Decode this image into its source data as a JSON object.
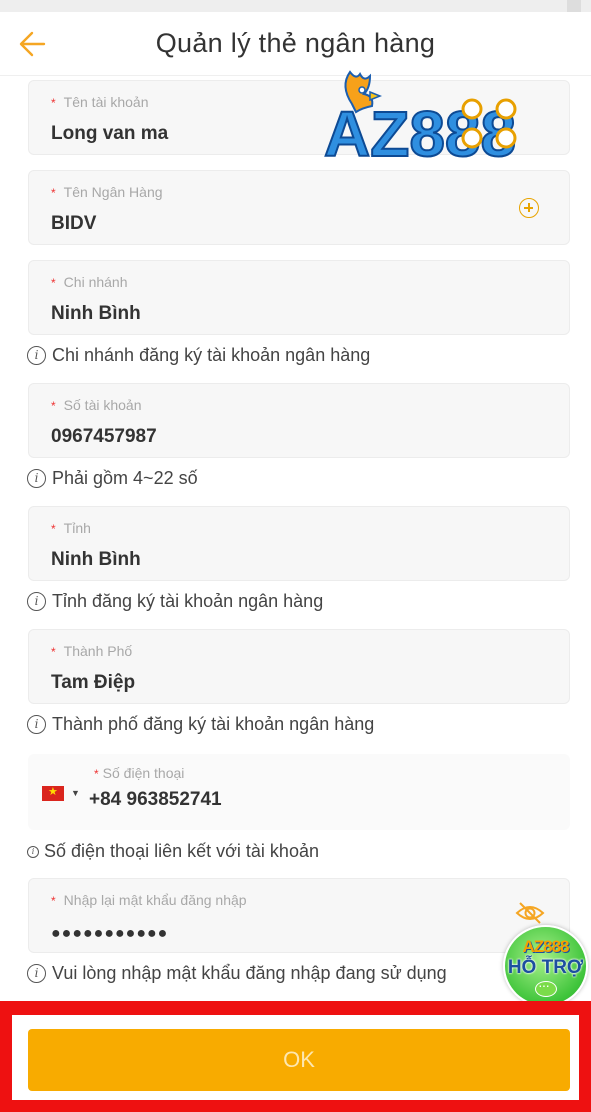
{
  "header": {
    "title": "Quản lý thẻ ngân hàng",
    "back_icon": "arrow-left-icon",
    "accent_color": "#f5a623"
  },
  "logo": {
    "text": "AZ888",
    "icon": "rooster-logo"
  },
  "form": {
    "required_mark": "*",
    "account_name": {
      "label": "Tên tài khoản",
      "value": "Long van ma"
    },
    "bank_name": {
      "label": "Tên Ngân Hàng",
      "value": "BIDV",
      "icon": "add-circle-icon"
    },
    "branch": {
      "label": "Chi nhánh",
      "value": "Ninh Bình",
      "hint": "Chi nhánh đăng ký tài khoản ngân hàng"
    },
    "account_number": {
      "label": "Số tài khoản",
      "value": "0967457987",
      "hint": "Phải gồm 4~22 số"
    },
    "province": {
      "label": "Tỉnh",
      "value": "Ninh Bình",
      "hint": "Tỉnh đăng ký tài khoản ngân hàng"
    },
    "city": {
      "label": "Thành Phố",
      "value": "Tam Điệp",
      "hint": "Thành phố đăng ký tài khoản ngân hàng"
    },
    "phone": {
      "label": "Số điện thoại",
      "value": "+84 963852741",
      "country_flag": "vietnam-flag",
      "hint": "Số điện thoại liên kết với tài khoản"
    },
    "password": {
      "label": "Nhập lại mật khẩu đăng nhập",
      "value": "●●●●●●●●●●●",
      "hint": "Vui lòng nhập mật khẩu đăng nhập đang sử dụng",
      "icon": "eye-icon"
    }
  },
  "support": {
    "brand": "AZ888",
    "label": "HỖ TRỢ",
    "icon": "chat-bubble-icon"
  },
  "submit": {
    "label": "OK",
    "color": "#f8ab00"
  },
  "highlight_color": "#ee1111"
}
